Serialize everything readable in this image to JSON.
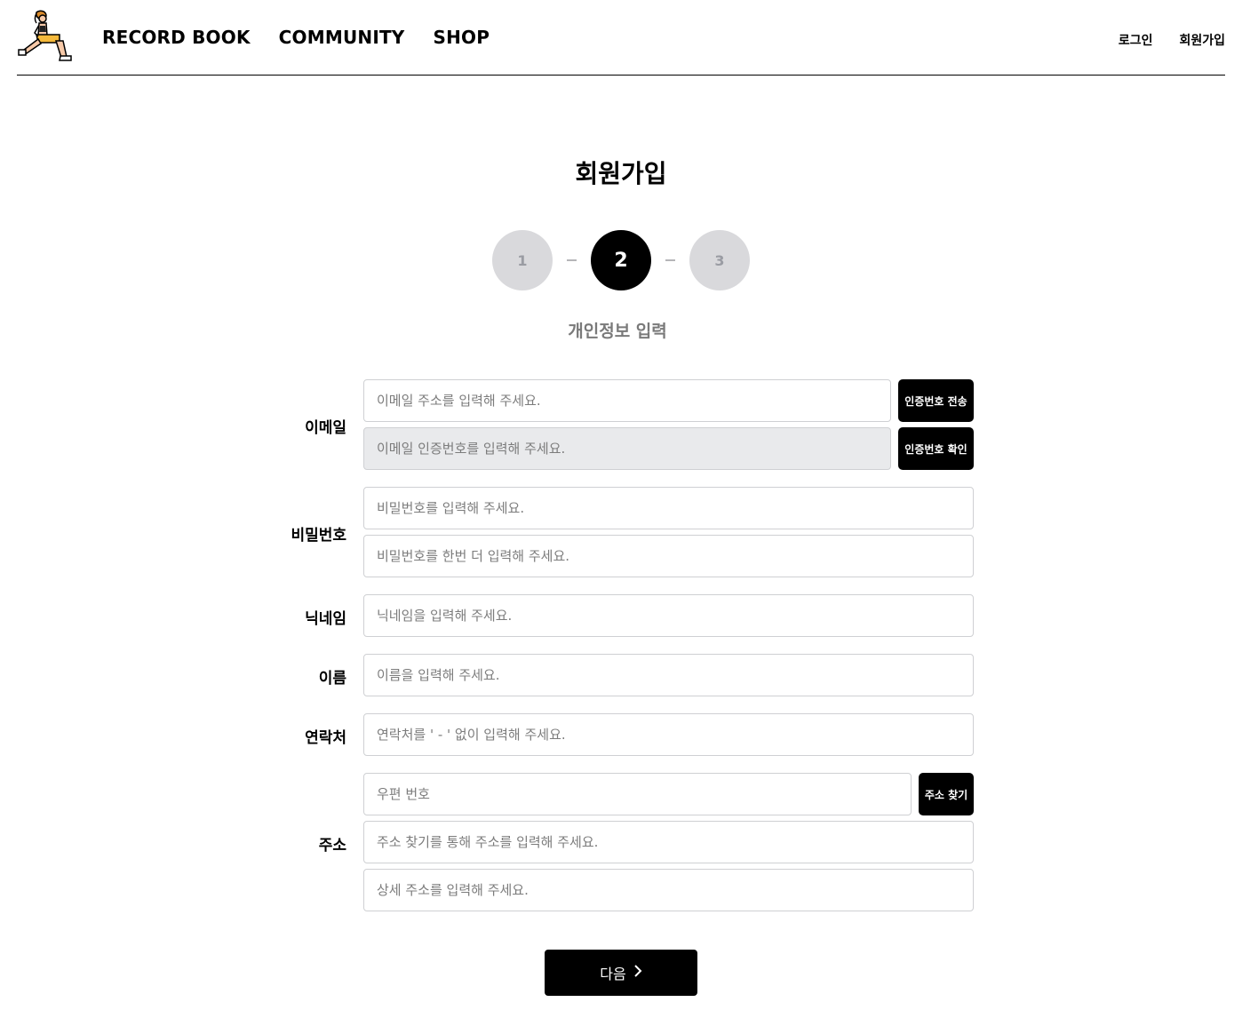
{
  "header": {
    "logo_icon": "lunging-runner-logo",
    "nav": [
      {
        "label": "RECORD BOOK"
      },
      {
        "label": "COMMUNITY"
      },
      {
        "label": "SHOP"
      }
    ],
    "auth": {
      "login": "로그인",
      "signup": "회원가입"
    }
  },
  "page": {
    "title": "회원가입",
    "steps": [
      "1",
      "2",
      "3"
    ],
    "current_step": 2,
    "step_caption": "개인정보 입력"
  },
  "form": {
    "email": {
      "label": "이메일",
      "placeholder": "이메일 주소를 입력해 주세요.",
      "send_button": "인증번호 전송",
      "code_placeholder": "이메일 인증번호를 입력해 주세요.",
      "verify_button": "인증번호 확인"
    },
    "password": {
      "label": "비밀번호",
      "placeholder": "비밀번호를 입력해 주세요.",
      "confirm_placeholder": "비밀번호를 한번 더 입력해 주세요."
    },
    "nickname": {
      "label": "닉네임",
      "placeholder": "닉네임을 입력해 주세요."
    },
    "name": {
      "label": "이름",
      "placeholder": "이름을 입력해 주세요."
    },
    "phone": {
      "label": "연락처",
      "placeholder": "연락처를 ' - ' 없이 입력해 주세요."
    },
    "address": {
      "label": "주소",
      "zip_placeholder": "우편 번호",
      "search_button": "주소 찾기",
      "address_placeholder": "주소 찾기를 통해 주소를 입력해 주세요.",
      "detail_placeholder": "상세 주소를 입력해 주세요."
    },
    "next_button": "다음"
  },
  "colors": {
    "primary": "#000000",
    "step_inactive_bg": "#d9d9dc",
    "step_inactive_text": "#9a9ca3",
    "input_border": "#cfd0d3",
    "disabled_bg": "#e9eaec",
    "caption_gray": "#7a7a7a"
  }
}
